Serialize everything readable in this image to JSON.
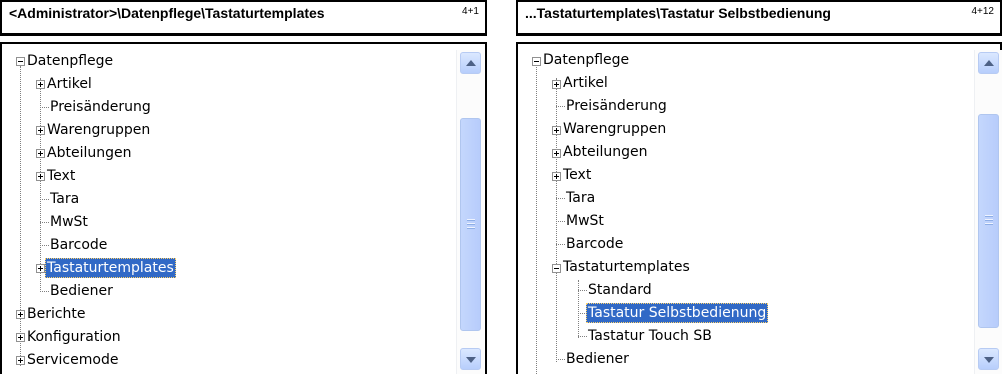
{
  "left": {
    "title": "<Administrator>\\Datenpflege\\Tastaturtemplates",
    "position": "4+1",
    "tree": {
      "root_label": "Datenpflege",
      "items": [
        {
          "label": "Artikel"
        },
        {
          "label": "Preisänderung"
        },
        {
          "label": "Warengruppen"
        },
        {
          "label": "Abteilungen"
        },
        {
          "label": "Text"
        },
        {
          "label": "Tara"
        },
        {
          "label": "MwSt"
        },
        {
          "label": "Barcode"
        },
        {
          "label": "Tastaturtemplates",
          "selected": true
        },
        {
          "label": "Bediener"
        }
      ],
      "top_level": [
        {
          "label": "Berichte"
        },
        {
          "label": "Konfiguration"
        },
        {
          "label": "Servicemode"
        }
      ]
    }
  },
  "right": {
    "title": "...Tastaturtemplates\\Tastatur Selbstbedienung",
    "position": "4+12",
    "tree": {
      "root_label": "Datenpflege",
      "items": [
        {
          "label": "Artikel"
        },
        {
          "label": "Preisänderung"
        },
        {
          "label": "Warengruppen"
        },
        {
          "label": "Abteilungen"
        },
        {
          "label": "Text"
        },
        {
          "label": "Tara"
        },
        {
          "label": "MwSt"
        },
        {
          "label": "Barcode"
        },
        {
          "label": "Tastaturtemplates"
        },
        {
          "label": "Bediener"
        }
      ],
      "templates": [
        {
          "label": "Standard"
        },
        {
          "label": "Tastatur Selbstbedienung",
          "selected": true
        },
        {
          "label": "Tastatur Touch SB"
        }
      ]
    }
  },
  "colors": {
    "selection": "#3169c6",
    "scrollbar_thumb": "#b7ccfb",
    "tree_lines": "#808080"
  }
}
